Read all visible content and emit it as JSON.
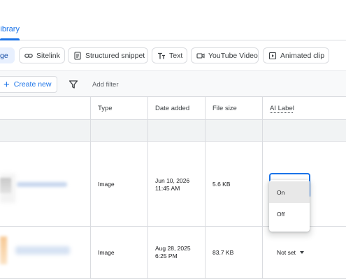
{
  "tabs": {
    "active_label": "library"
  },
  "chips": [
    {
      "label": "ge",
      "icon": "image-icon",
      "selected": true
    },
    {
      "label": "Sitelink",
      "icon": "link-icon"
    },
    {
      "label": "Structured snippet",
      "icon": "snippet-icon"
    },
    {
      "label": "Text",
      "icon": "text-icon"
    },
    {
      "label": "YouTube Video",
      "icon": "video-icon"
    },
    {
      "label": "Animated clip",
      "icon": "animated-clip-icon"
    }
  ],
  "toolbar": {
    "create_label": "Create new",
    "filter_label": "Add filter"
  },
  "table": {
    "headers": {
      "type": "Type",
      "date": "Date added",
      "size": "File size",
      "ai": "AI Label"
    },
    "rows": [
      {
        "type": "Image",
        "date_line1": "Jun 10, 2026",
        "date_line2": "11:45 AM",
        "size": "5.6 KB",
        "ai_label": ""
      },
      {
        "type": "Image",
        "date_line1": "Aug 28, 2025",
        "date_line2": "6:25 PM",
        "size": "83.7 KB",
        "ai_label": "Not set"
      }
    ]
  },
  "ai_menu": {
    "options": [
      "On",
      "Off"
    ],
    "highlighted": "On"
  },
  "colors": {
    "accent": "#1a73e8",
    "border": "#dadce0",
    "band": "#f1f3f4"
  }
}
